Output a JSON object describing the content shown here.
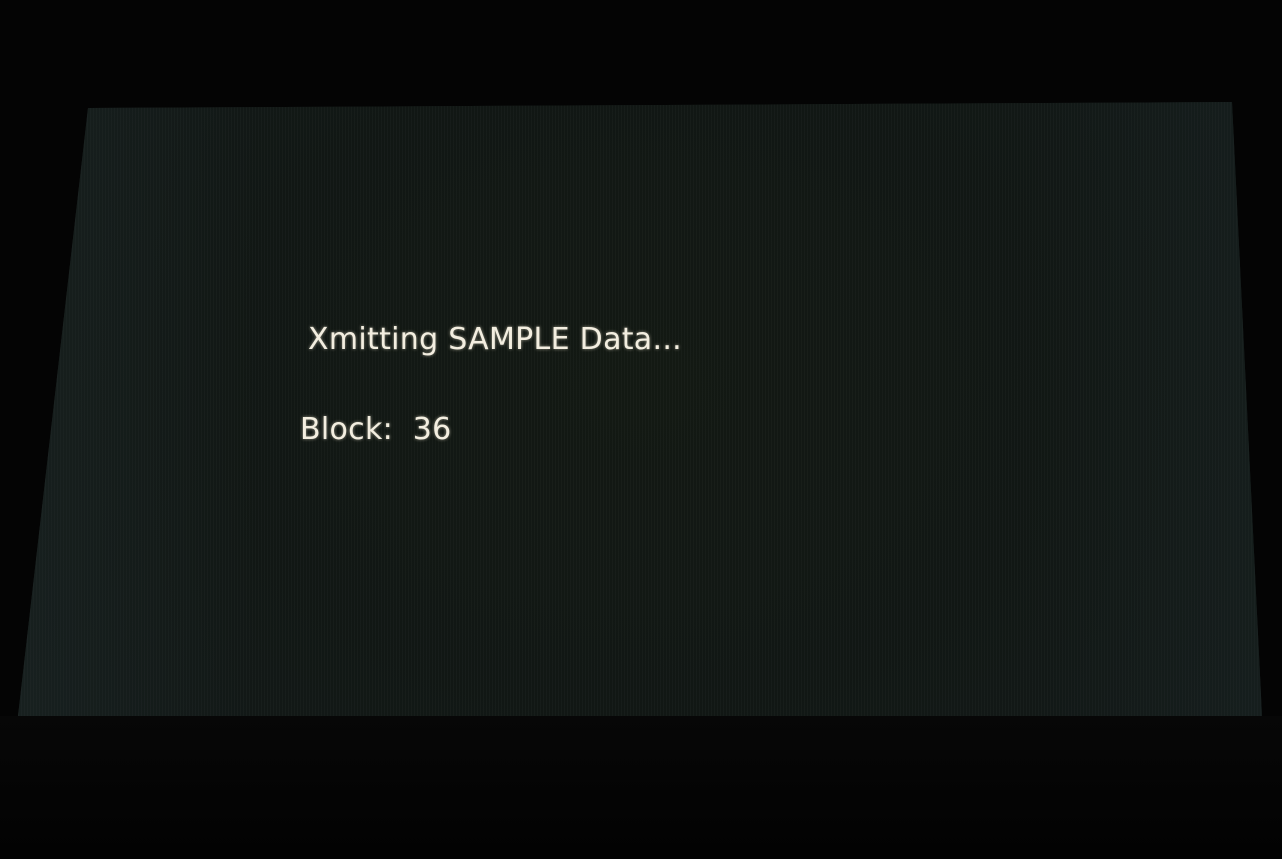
{
  "display": {
    "status_message": "Xmitting SAMPLE Data...",
    "block_label": "Block:",
    "block_value": "36"
  }
}
